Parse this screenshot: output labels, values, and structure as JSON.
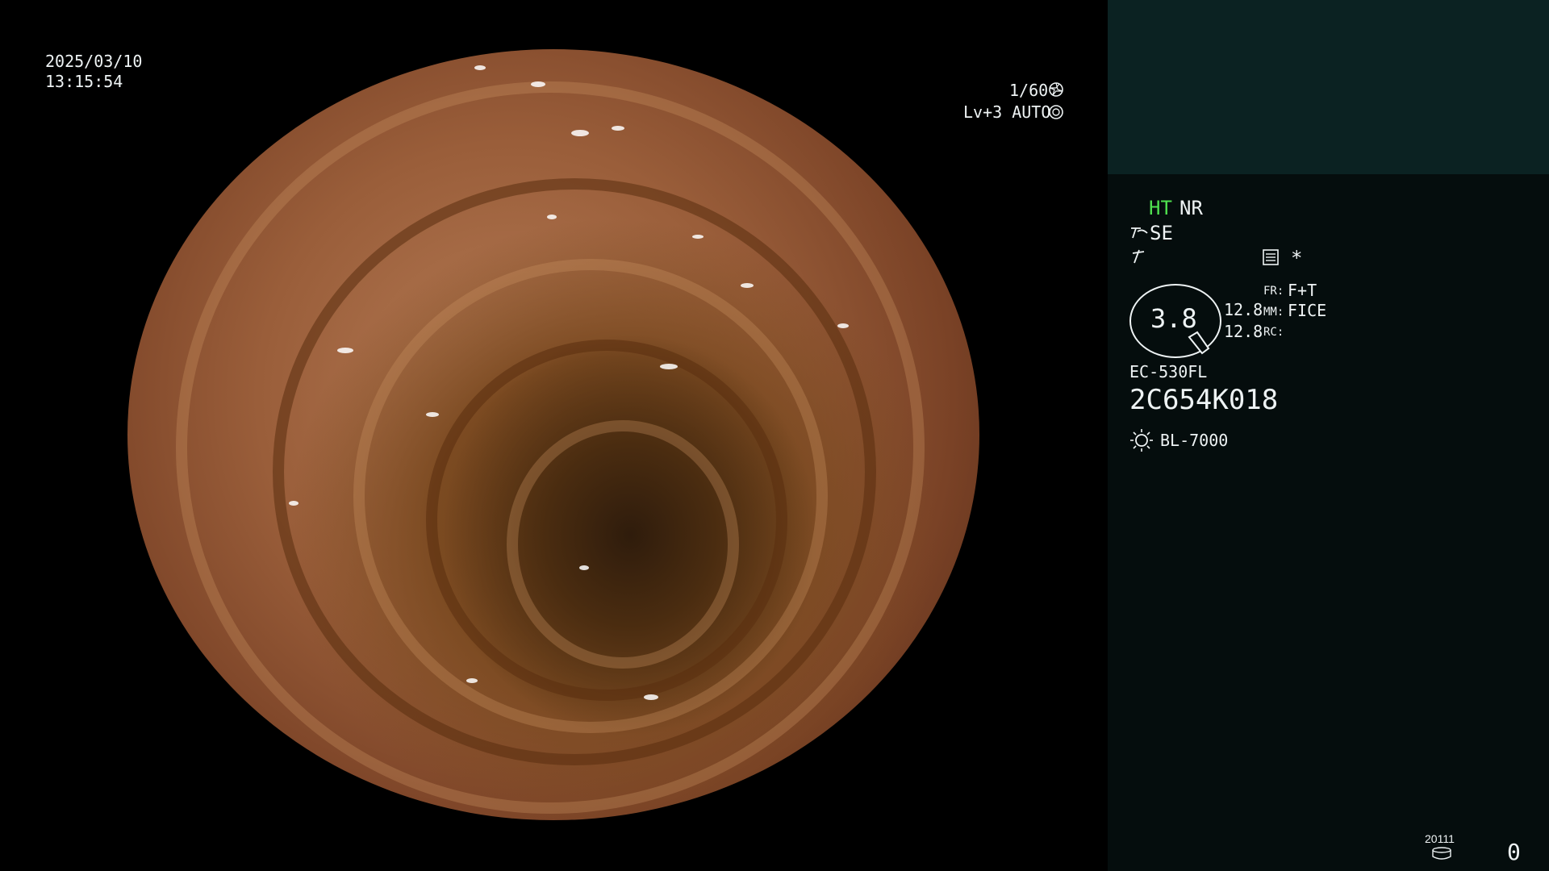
{
  "overlay": {
    "date": "2025/03/10",
    "time": "13:15:54",
    "shutter": "1/60",
    "level": "Lv+3 AUTO"
  },
  "status_panel": {
    "ht": "HT",
    "nr": "NR",
    "se": "SE",
    "ring_value": "3.8",
    "zoom_top": "12.8",
    "zoom_bottom": "12.8",
    "fr_label": "FR:",
    "fr_value": "F+T",
    "mm_label": "MM:",
    "mm_value": "FICE",
    "rc_label": "RC:",
    "scope_model": "EC-530FL",
    "serial": "2C654K018",
    "light_source": "BL-7000",
    "storage_count": "20111",
    "counter": "0",
    "asterisk": "*"
  },
  "colors": {
    "background": "#000000",
    "panel": "#050d0d",
    "panel_top": "#0b2222",
    "ht_green": "#4fe14f",
    "text": "#eef3f4"
  },
  "icons": [
    "shutter-icon",
    "auto-iris-icon",
    "se-icon",
    "pen-icon",
    "menu-list-icon",
    "light-icon",
    "storage-icon"
  ]
}
